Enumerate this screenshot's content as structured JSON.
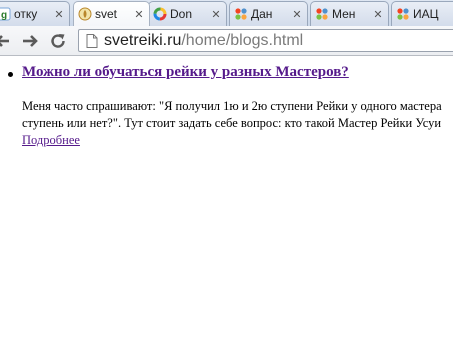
{
  "tabs": [
    {
      "title": "отку",
      "icon": "google-icon",
      "active": false
    },
    {
      "title": "svet",
      "icon": "svetreiki-icon",
      "active": true
    },
    {
      "title": "Don",
      "icon": "donut-icon",
      "active": false
    },
    {
      "title": "Дан",
      "icon": "joomla-icon",
      "active": false
    },
    {
      "title": "Мен",
      "icon": "joomla-icon",
      "active": false
    },
    {
      "title": "ИАЦ",
      "icon": "joomla-icon",
      "active": false
    }
  ],
  "address_bar": {
    "host": "svetreiki.ru",
    "path": "/home/blogs.html"
  },
  "post": {
    "title": "Можно ли обучаться рейки у разных Мастеров?",
    "text_lines": [
      "Меня часто спрашивают: \"Я получил 1ю и 2ю ступени Рейки у одного мастера",
      "ступень или нет?\". Тут стоит задать себе вопрос: кто такой Мастер Рейки Усуи"
    ],
    "more_label": "Подробнее"
  },
  "colors": {
    "visited_link": "#551a8b",
    "tabstrip": "#cbd8ea"
  }
}
